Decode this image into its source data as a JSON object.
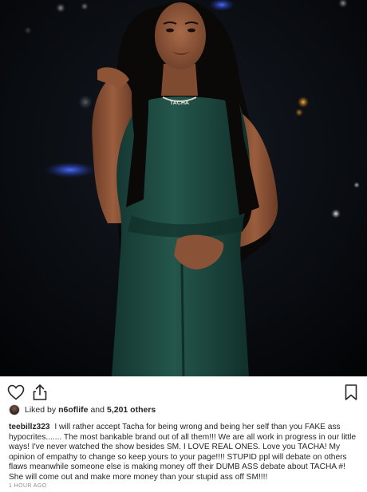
{
  "post": {
    "photo": {
      "alt_name": "woman-in-green-jumpsuit",
      "necklace_text": "TACHA"
    },
    "actions": {
      "heart_icon": "heart-icon",
      "share_icon": "share-icon",
      "bookmark_icon": "bookmark-icon"
    },
    "likes": {
      "prefix": "Liked by",
      "liker": "n6oflife",
      "joiner": "and",
      "others": "5,201 others"
    },
    "caption": {
      "username": "teebillz323",
      "text": "I will rather accept Tacha for being wrong and being her self than you FAKE ass hypocrites....... The most bankable brand out of all them!!! We are all work in progress in our little ways! I've never watched the show besides SM. I LOVE REAL ONES. Love you TACHA! My opinion of empathy to change so keep yours to your page!!!! STUPID ppl will debate on others flaws meanwhile someone else is making money off their DUMB ASS debate about TACHA #! She will come out and make more money than your stupid ass off SM!!!!"
    },
    "timestamp": "1 HOUR AGO"
  },
  "colors": {
    "text": "#262626",
    "muted": "#8e8e8e",
    "photo_background": "#06080c",
    "jumpsuit": "#1f4a42",
    "skin": "#8a5236",
    "hair": "#0b0908"
  }
}
